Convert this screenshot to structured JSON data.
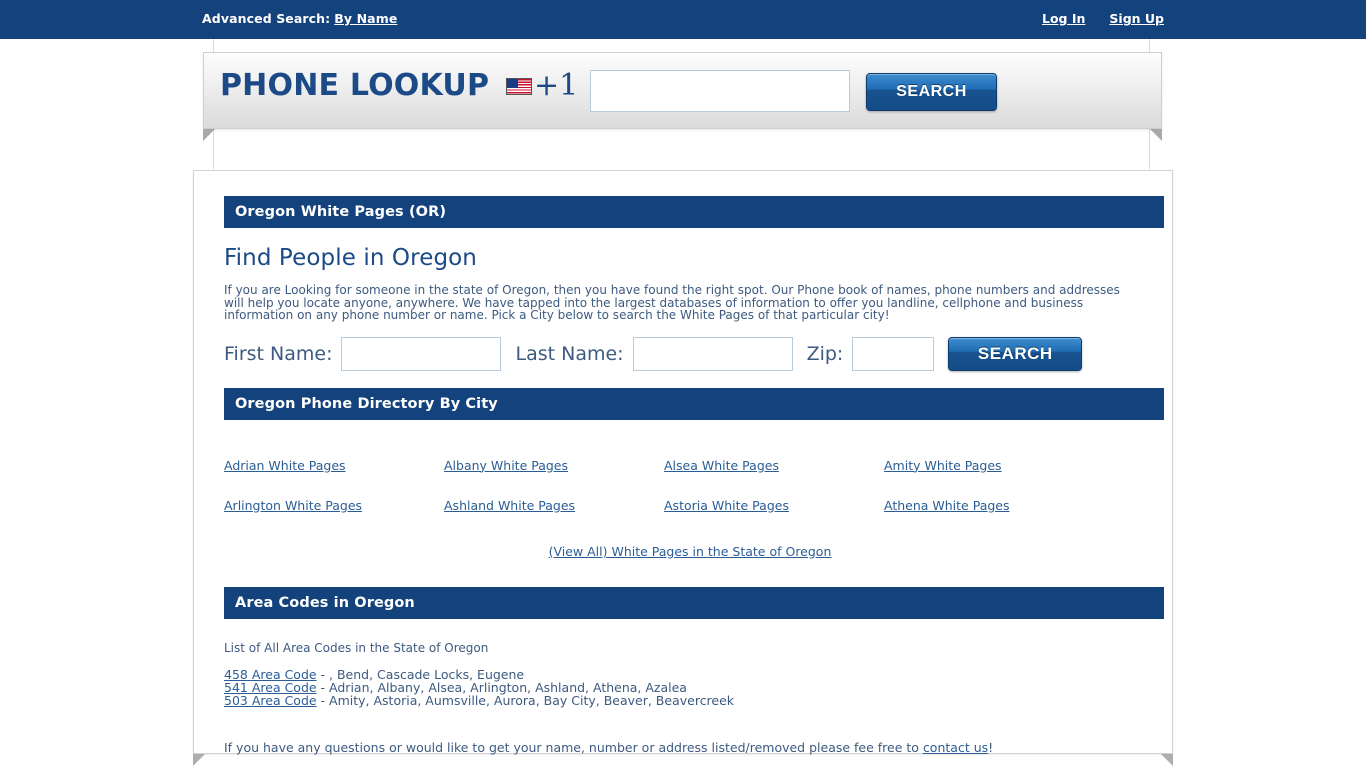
{
  "topbar": {
    "advanced_search_label": "Advanced Search:",
    "advanced_search_link": "By Name",
    "login_label": "Log In",
    "signup_label": "Sign Up"
  },
  "lookup": {
    "title": "PHONE LOOKUP",
    "country_code": "+1",
    "flag_icon": "us-flag-icon",
    "input_value": "",
    "input_placeholder": "",
    "search_label": "SEARCH"
  },
  "main": {
    "section_title": "Oregon White Pages (OR)",
    "heading": "Find People in Oregon",
    "intro": "If you are Looking for someone in the state of Oregon, then you have found the right spot. Our Phone book of names, phone numbers and addresses will help you locate anyone, anywhere. We have tapped into the largest databases of information to offer you landline, cellphone and business information on any phone number or name. Pick a City below to search the White Pages of that particular city!",
    "form": {
      "first_name_label": "First Name:",
      "first_name_value": "",
      "last_name_label": "Last Name:",
      "last_name_value": "",
      "zip_label": "Zip:",
      "zip_value": "",
      "search_label": "SEARCH"
    },
    "city_section_title": "Oregon Phone Directory By City",
    "cities": [
      "Adrian White Pages",
      "Albany White Pages",
      "Alsea White Pages",
      "Amity White Pages",
      "Arlington White Pages",
      "Ashland White Pages",
      "Astoria White Pages",
      "Athena White Pages"
    ],
    "view_all": "(View All) White Pages in the State of Oregon",
    "area_section_title": "Area Codes in Oregon",
    "area_intro": "List of All Area Codes in the State of Oregon",
    "area_codes": [
      {
        "code": "458 Area Code",
        "cities": " - , Bend, Cascade Locks, Eugene"
      },
      {
        "code": "541 Area Code",
        "cities": " - Adrian, Albany, Alsea, Arlington, Ashland, Athena, Azalea"
      },
      {
        "code": "503 Area Code",
        "cities": " - Amity, Astoria, Aumsville, Aurora, Bay City, Beaver, Beavercreek"
      }
    ],
    "contact": {
      "prefix": "If you have any questions or would like to get your name, number or address listed/removed please fee free to ",
      "link": "contact us",
      "suffix": "!"
    }
  },
  "colors": {
    "brand_blue": "#14427c",
    "link_blue": "#2a5d96",
    "text_blue": "#3d5a80",
    "heading_blue": "#1b4a86"
  }
}
